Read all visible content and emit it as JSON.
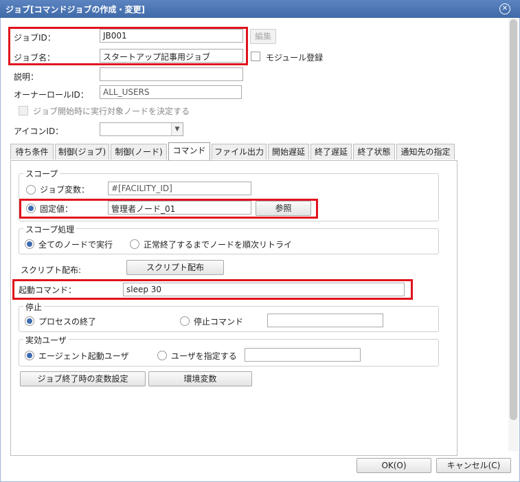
{
  "window": {
    "title": "ジョブ[コマンドジョブの作成・変更]"
  },
  "form": {
    "job_id_label": "ジョブID：",
    "job_id_value": "JB001",
    "edit_button": "編集",
    "job_name_label": "ジョブ名：",
    "job_name_value": "スタートアップ記事用ジョブ",
    "module_register_label": "モジュール登録",
    "description_label": "説明：",
    "description_value": "",
    "owner_role_label": "オーナーロールID：",
    "owner_role_value": "ALL_USERS",
    "decide_node_label": "ジョブ開始時に実行対象ノードを決定する",
    "icon_id_label": "アイコンID：",
    "icon_id_value": ""
  },
  "tabs": [
    {
      "label": "待ち条件"
    },
    {
      "label": "制御(ジョブ)"
    },
    {
      "label": "制御(ノード)"
    },
    {
      "label": "コマンド"
    },
    {
      "label": "ファイル出力"
    },
    {
      "label": "開始遅延"
    },
    {
      "label": "終了遅延"
    },
    {
      "label": "終了状態"
    },
    {
      "label": "通知先の指定"
    }
  ],
  "active_tab": "コマンド",
  "scope": {
    "legend": "スコープ",
    "job_var_label": "ジョブ変数：",
    "job_var_value": "#[FACILITY_ID]",
    "fixed_label": "固定値：",
    "fixed_value": "管理者ノード_01",
    "browse_button": "参照"
  },
  "scope_processing": {
    "legend": "スコープ処理",
    "all_nodes_label": "全てのノードで実行",
    "retry_label": "正常終了するまでノードを順次リトライ"
  },
  "script": {
    "label": "スクリプト配布:",
    "button": "スクリプト配布"
  },
  "command": {
    "label": "起動コマンド：",
    "value": "sleep 30"
  },
  "stop": {
    "legend": "停止",
    "process_end_label": "プロセスの終了",
    "stop_command_label": "停止コマンド",
    "stop_command_value": ""
  },
  "effective_user": {
    "legend": "実効ユーザ",
    "agent_user_label": "エージェント起動ユーザ",
    "specify_user_label": "ユーザを指定する",
    "user_value": ""
  },
  "bottom_buttons": {
    "var_setting": "ジョブ終了時の変数設定",
    "env_var": "環境変数"
  },
  "dialog_buttons": {
    "ok": "OK(O)",
    "cancel": "キャンセル(C)"
  },
  "colors": {
    "highlight": "#e0121c",
    "titlebar": "#4a74b4",
    "radio_on": "#3d6bb0"
  }
}
